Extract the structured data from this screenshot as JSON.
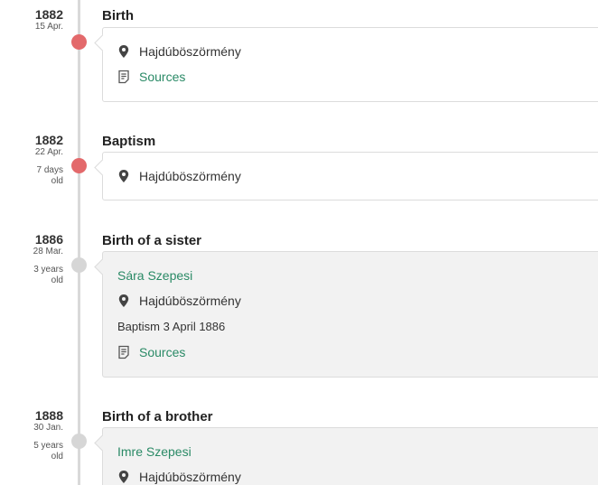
{
  "events": [
    {
      "year": "1882",
      "day": "15 Apr.",
      "age": "",
      "title": "Birth",
      "place": "Hajdúböszörmény",
      "sources_label": "Sources"
    },
    {
      "year": "1882",
      "day": "22 Apr.",
      "age": "7 days old",
      "title": "Baptism",
      "place": "Hajdúböszörmény"
    },
    {
      "year": "1886",
      "day": "28 Mar.",
      "age": "3 years old",
      "title": "Birth of a sister",
      "person": "Sára Szepesi",
      "place": "Hajdúböszörmény",
      "note": "Baptism 3 April 1886",
      "sources_label": "Sources"
    },
    {
      "year": "1888",
      "day": "30 Jan.",
      "age": "5 years old",
      "title": "Birth of a brother",
      "person": "Imre Szepesi",
      "place": "Hajdúböszörmény"
    }
  ],
  "colors": {
    "marker_event": "#e3696b",
    "marker_family": "#d6d6d6",
    "link": "#2a8a66"
  },
  "icons": {
    "place": "map-pin-icon",
    "sources": "document-icon"
  }
}
